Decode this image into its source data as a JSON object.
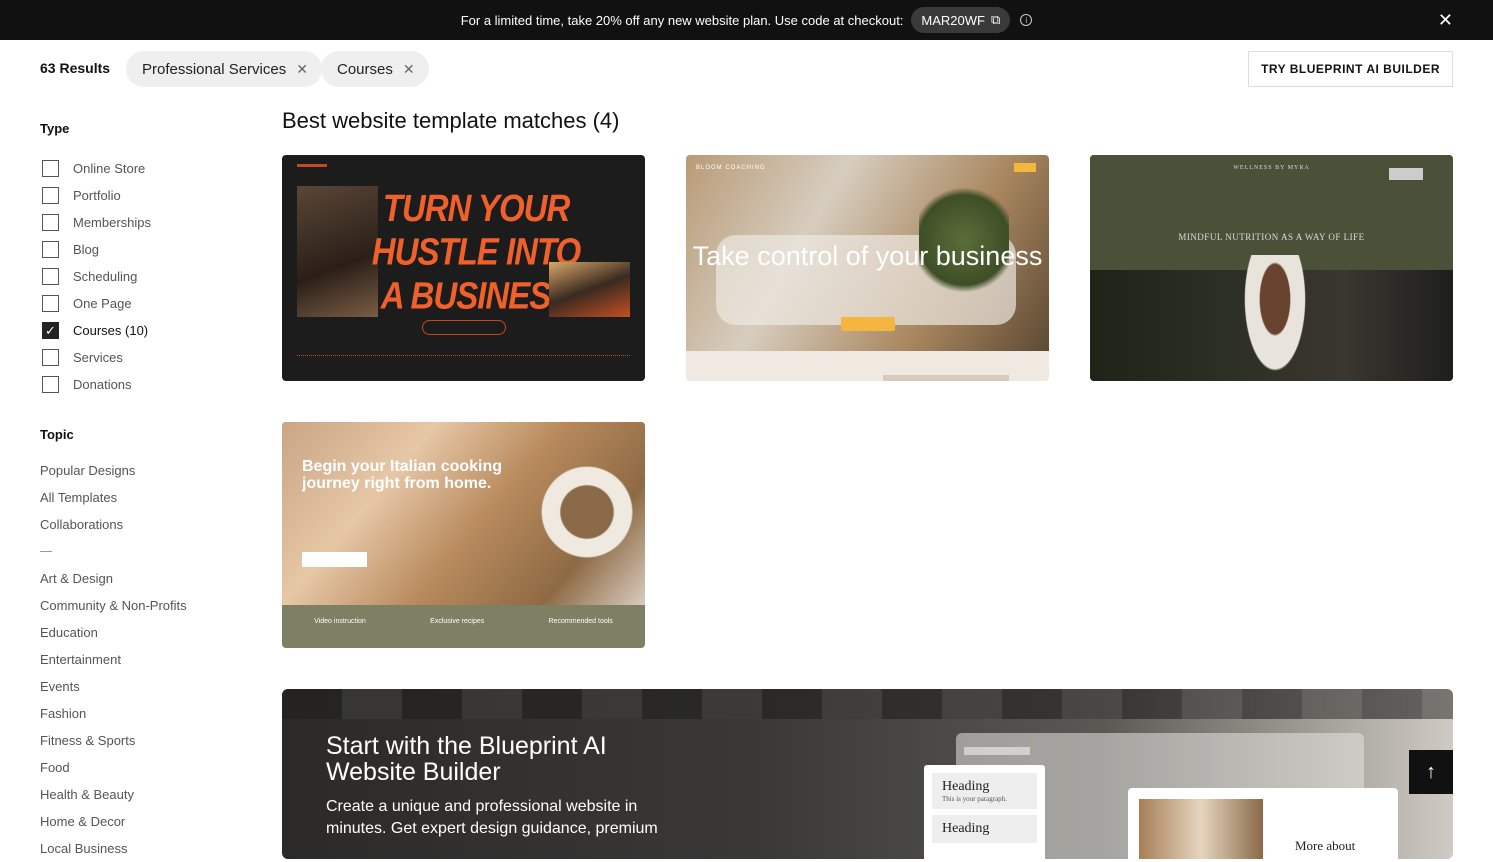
{
  "promo": {
    "text": "For a limited time, take 20% off any new website plan. Use code at checkout:",
    "code": "MAR20WF",
    "copy_icon": "copy-icon",
    "info_icon": "info-icon",
    "close_icon": "close-icon"
  },
  "results": {
    "count": "63 Results",
    "chips": [
      {
        "label": "Professional Services"
      },
      {
        "label": "Courses"
      }
    ],
    "ai_button": "TRY BLUEPRINT AI BUILDER"
  },
  "sidebar": {
    "type_heading": "Type",
    "types": [
      {
        "label": "Online Store",
        "checked": false
      },
      {
        "label": "Portfolio",
        "checked": false
      },
      {
        "label": "Memberships",
        "checked": false
      },
      {
        "label": "Blog",
        "checked": false
      },
      {
        "label": "Scheduling",
        "checked": false
      },
      {
        "label": "One Page",
        "checked": false
      },
      {
        "label": "Courses (10)",
        "checked": true
      },
      {
        "label": "Services",
        "checked": false
      },
      {
        "label": "Donations",
        "checked": false
      }
    ],
    "topic_heading": "Topic",
    "topics_top": [
      "Popular Designs",
      "All Templates",
      "Collaborations"
    ],
    "topics": [
      "Art & Design",
      "Community & Non-Profits",
      "Education",
      "Entertainment",
      "Events",
      "Fashion",
      "Fitness & Sports",
      "Food",
      "Health & Beauty",
      "Home & Decor",
      "Local Business"
    ]
  },
  "main": {
    "section_title": "Best website template matches (4)",
    "cards": [
      {
        "headline": "TURN YOUR HUSTLE INTO A BUSINESS"
      },
      {
        "brand": "BLOOM COACHING",
        "headline": "Take control of your business"
      },
      {
        "brand": "WELLNESS BY MYRA",
        "headline": "MINDFUL NUTRITION AS A WAY OF LIFE"
      },
      {
        "headline": "Begin your Italian cooking journey right from home.",
        "features": [
          "Video instruction",
          "Exclusive recipes",
          "Recommended tools"
        ]
      }
    ]
  },
  "banner": {
    "title": "Start with the Blueprint AI Website Builder",
    "description": "Create a unique and professional website in minutes. Get expert design guidance, premium",
    "panel_heading_1": "Heading",
    "panel_paragraph_1": "This is your paragraph.",
    "panel_heading_2": "Heading",
    "card_text": "More about"
  },
  "scroll_top_icon": "arrow-up-icon"
}
